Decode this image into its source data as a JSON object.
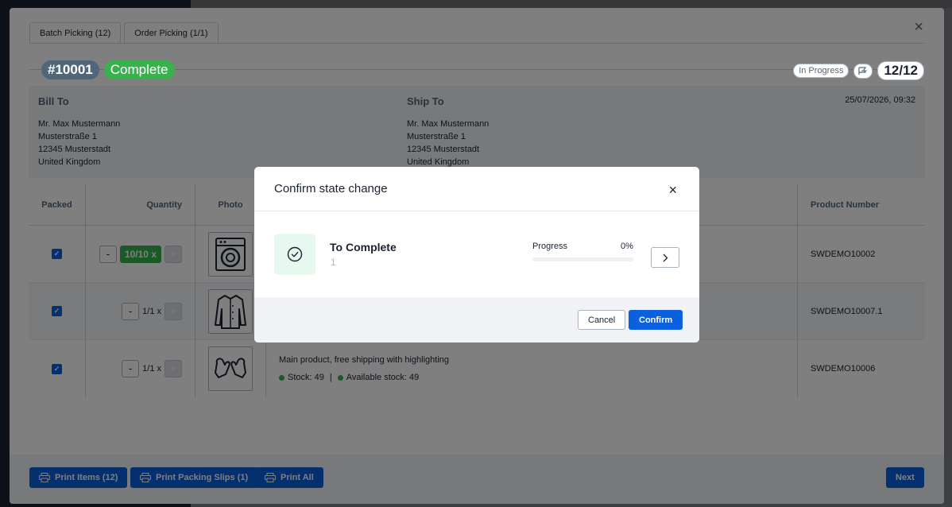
{
  "tabs": [
    {
      "label": "Batch Picking (12)"
    },
    {
      "label": "Order Picking (1/1)"
    }
  ],
  "order": {
    "number": "#10001",
    "state": "Complete",
    "status": "In Progress",
    "counter": "12/12"
  },
  "bill_to": {
    "heading": "Bill To",
    "name": "Mr. Max Mustermann",
    "street": "Musterstraße 1",
    "city": "12345 Musterstadt",
    "country": "United Kingdom"
  },
  "ship_to": {
    "heading": "Ship To",
    "name": "Mr. Max Mustermann",
    "street": "Musterstraße 1",
    "city": "12345 Musterstadt",
    "country": "United Kingdom"
  },
  "date": "25/07/2026, 09:32",
  "table": {
    "headers": {
      "packed": "Packed",
      "quantity": "Quantity",
      "photo": "Photo",
      "product_number": "Product Number"
    },
    "rows": [
      {
        "qty": "10/10 x",
        "product_number": "SWDEMO10002",
        "description": "",
        "stock": "",
        "available": "",
        "icon": "washing-machine-icon"
      },
      {
        "qty": "1/1 x",
        "product_number": "SWDEMO10007.1",
        "description": "",
        "stock": "",
        "available": "",
        "icon": "jacket-icon"
      },
      {
        "qty": "1/1 x",
        "product_number": "SWDEMO10006",
        "description": "Main product, free shipping with highlighting",
        "stock": "Stock: 49",
        "available": "Available stock: 49",
        "icon": "mittens-icon"
      }
    ],
    "minus": "-",
    "plus": "+"
  },
  "footer": {
    "print_items": "Print Items (12)",
    "print_slips": "Print Packing Slips (1)",
    "print_all": "Print All",
    "next": "Next"
  },
  "dialog": {
    "title": "Confirm state change",
    "state_name": "To Complete",
    "state_count": "1",
    "progress_label": "Progress",
    "progress_pct": "0%",
    "progress_value": 0,
    "cancel": "Cancel",
    "confirm": "Confirm"
  },
  "colors": {
    "accent": "#0b60e0",
    "success": "#37b24d"
  }
}
